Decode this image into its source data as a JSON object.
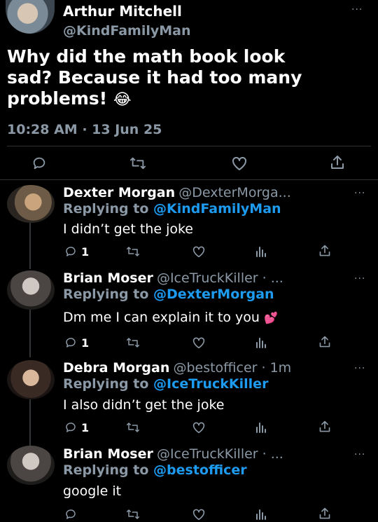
{
  "main_tweet": {
    "author_name": "Arthur Mitchell",
    "handle": "@KindFamilyMan",
    "text_line1": "Why did the math book look",
    "text_line2": "sad? Because it had too many",
    "text_line3": "problems!",
    "emoji": "😂",
    "timestamp": "10:28 AM · 13 Jun 25"
  },
  "replies": [
    {
      "author_name": "Dexter Morgan",
      "handle_meta": "@DexterMorga...",
      "replying_prefix": "Replying to ",
      "replying_to": "@KindFamilyMan",
      "text": "I didn’t get the joke",
      "reply_count": "1"
    },
    {
      "author_name": "Brian Moser",
      "handle_meta": "@IceTruckKiller · ...",
      "replying_prefix": "Replying to ",
      "replying_to": "@DexterMorgan",
      "text": "Dm me I can explain it to you",
      "emoji": "💕",
      "reply_count": "1"
    },
    {
      "author_name": "Debra Morgan",
      "handle_meta": "@bestofficer · 1m",
      "replying_prefix": "Replying to ",
      "replying_to": "@IceTruckKiller",
      "text": "I also didn’t get the joke",
      "reply_count": "1"
    },
    {
      "author_name": "Brian Moser",
      "handle_meta": "@IceTruckKiller · ...",
      "replying_prefix": "Replying to ",
      "replying_to": "@bestofficer",
      "text": "google it"
    }
  ],
  "more_label": "···",
  "colors": {
    "background": "#000000",
    "muted": "#8b98a5",
    "link": "#1d9bf0",
    "divider": "#2f3336"
  },
  "icons": [
    "reply-icon",
    "retweet-icon",
    "like-icon",
    "views-icon",
    "share-icon"
  ]
}
